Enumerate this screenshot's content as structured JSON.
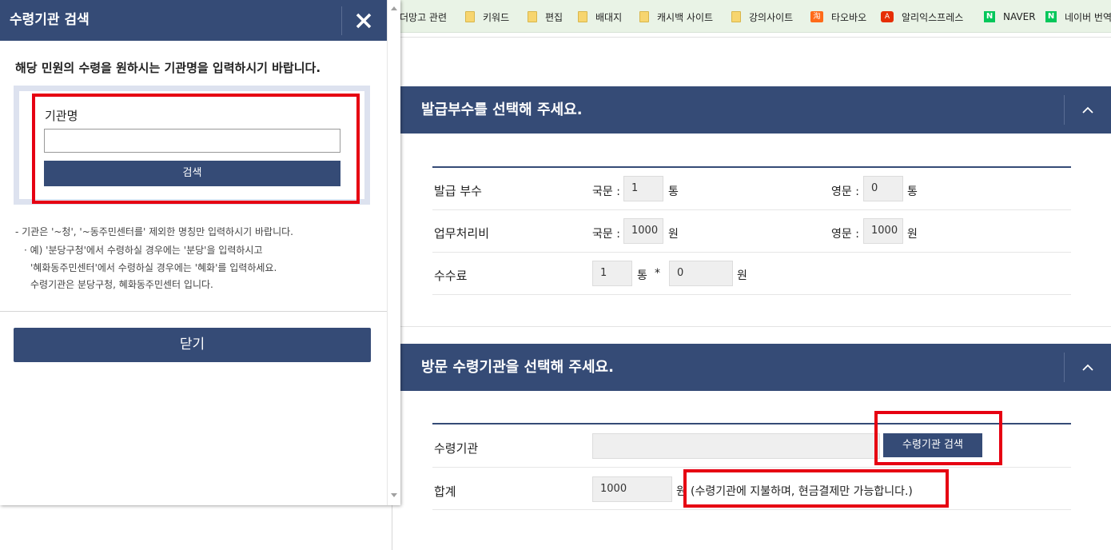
{
  "bookmarks": [
    {
      "label": "더망고 관련",
      "icon": "none"
    },
    {
      "label": "키워드",
      "icon": "folder-icon"
    },
    {
      "label": "편집",
      "icon": "folder-icon"
    },
    {
      "label": "배대지",
      "icon": "folder-icon"
    },
    {
      "label": "캐시백 사이트",
      "icon": "folder-icon"
    },
    {
      "label": "강의사이트",
      "icon": "folder-icon"
    },
    {
      "label": "타오바오",
      "icon": "taobao-icon",
      "glyph": "淘"
    },
    {
      "label": "알리익스프레스",
      "icon": "aliexpress-icon",
      "glyph": "A"
    },
    {
      "label": "NAVER",
      "icon": "naver-icon",
      "glyph": "N"
    },
    {
      "label": "네이버 번역",
      "icon": "naver-icon",
      "glyph": "N"
    }
  ],
  "copies_section": {
    "title": "발급부수를 선택해 주세요.",
    "rows": {
      "issue_count": {
        "label": "발급 부수",
        "kor_label": "국문 :",
        "kor_value": "1",
        "kor_unit": "통",
        "eng_label": "영문 :",
        "eng_value": "0",
        "eng_unit": "통"
      },
      "processing_fee": {
        "label": "업무처리비",
        "kor_label": "국문 :",
        "kor_value": "1000",
        "kor_unit": "원",
        "eng_label": "영문 :",
        "eng_value": "1000",
        "eng_unit": "원"
      },
      "commission": {
        "label": "수수료",
        "count": "1",
        "count_unit": "통",
        "times": "*",
        "fee": "0",
        "fee_unit": "원"
      }
    }
  },
  "receive_section": {
    "title": "방문 수령기관을 선택해 주세요.",
    "agency_label": "수령기관",
    "agency_value": "",
    "search_button": "수령기관 검색",
    "total_label": "합계",
    "total_value": "1000",
    "total_unit": "원",
    "total_note": "(수령기관에 지불하며, 현금결제만 가능합니다.)"
  },
  "popup": {
    "title": "수령기관 검색",
    "guide": "해당 민원의 수령을 원하시는 기관명을 입력하시기 바랍니다.",
    "field_label": "기관명",
    "field_value": "",
    "search_button": "검색",
    "notes": [
      "- 기관은 '~청', '~동주민센터를' 제외한 명칭만 입력하시기 바랍니다.",
      "· 예) '분당구청'에서 수령하실 경우에는 '분당'을 입력하시고",
      "'혜화동주민센터'에서 수령하실 경우에는 '혜화'를 입력하세요.",
      "수령기관은 분당구청, 혜화동주민센터 입니다."
    ],
    "close_button": "닫기"
  },
  "colors": {
    "navy": "#354b76",
    "highlight_red": "#e60012",
    "bookmark_bg": "#e9f3e6"
  }
}
